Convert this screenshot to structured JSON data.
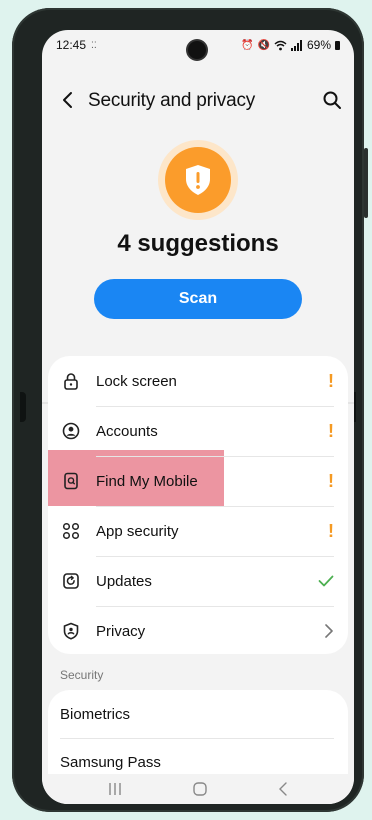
{
  "status_bar": {
    "time": "12:45",
    "battery": "69%"
  },
  "header": {
    "title": "Security and privacy"
  },
  "hero": {
    "suggestions": "4 suggestions",
    "scan_label": "Scan"
  },
  "list": {
    "items": [
      {
        "label": "Lock screen",
        "icon": "lock-icon",
        "status": "!"
      },
      {
        "label": "Accounts",
        "icon": "account-icon",
        "status": "!"
      },
      {
        "label": "Find My Mobile",
        "icon": "find-my-mobile-icon",
        "status": "!"
      },
      {
        "label": "App security",
        "icon": "app-security-icon",
        "status": "!"
      },
      {
        "label": "Updates",
        "icon": "updates-icon",
        "status": "check"
      },
      {
        "label": "Privacy",
        "icon": "privacy-icon",
        "status": "chevron"
      }
    ]
  },
  "security_section": {
    "header": "Security",
    "items": [
      {
        "label": "Biometrics"
      },
      {
        "label": "Samsung Pass"
      }
    ]
  },
  "colors": {
    "accent": "#1a86f3",
    "warning": "#f59a23",
    "ok": "#4caf50",
    "highlight": "#e46c7d"
  }
}
